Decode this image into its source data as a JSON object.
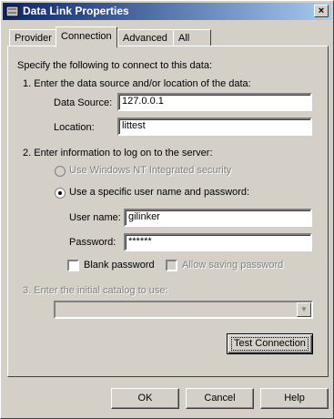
{
  "window": {
    "title": "Data Link Properties",
    "close_label": "×",
    "icon": "data-link-icon"
  },
  "tabs": [
    {
      "label": "Provider"
    },
    {
      "label": "Connection"
    },
    {
      "label": "Advanced"
    },
    {
      "label": "All"
    }
  ],
  "connection": {
    "intro": "Specify the following to connect to this data:",
    "step1": "1. Enter the data source and/or location of the data:",
    "data_source_label": "Data Source:",
    "data_source_value": "127.0.0.1",
    "location_label": "Location:",
    "location_value": "littest",
    "step2": "2. Enter information to log on to the server:",
    "nt_security_label": "Use Windows NT Integrated security",
    "specific_user_label": "Use a specific user name and password:",
    "username_label": "User name:",
    "username_value": "gilinker",
    "password_label": "Password:",
    "password_value": "******",
    "blank_password_label": "Blank password",
    "allow_saving_label": "Allow saving password",
    "step3": "3. Enter the initial catalog to use:",
    "catalog_value": "",
    "test_connection_label": "Test Connection"
  },
  "footer": {
    "ok_label": "OK",
    "cancel_label": "Cancel",
    "help_label": "Help"
  }
}
